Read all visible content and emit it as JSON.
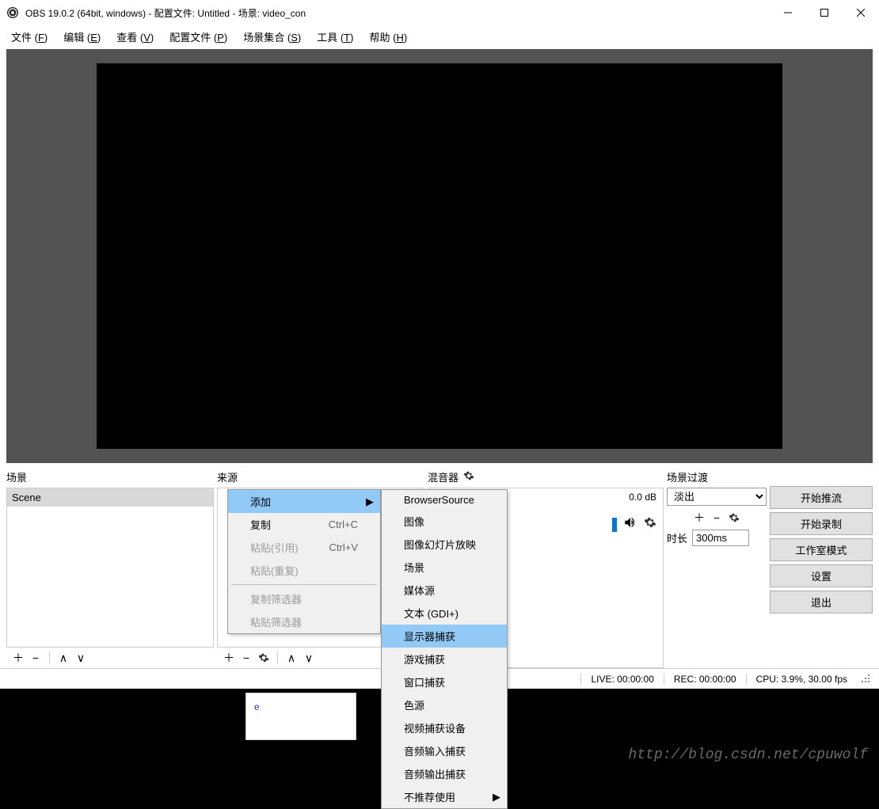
{
  "titlebar": {
    "title": "OBS 19.0.2 (64bit, windows) - 配置文件: Untitled - 场景: video_con"
  },
  "menubar": {
    "items": [
      {
        "label": "文件",
        "accel": "F"
      },
      {
        "label": "编辑",
        "accel": "E"
      },
      {
        "label": "查看",
        "accel": "V"
      },
      {
        "label": "配置文件",
        "accel": "P"
      },
      {
        "label": "场景集合",
        "accel": "S"
      },
      {
        "label": "工具",
        "accel": "T"
      },
      {
        "label": "帮助",
        "accel": "H"
      }
    ]
  },
  "panels": {
    "scenes": {
      "title": "场景",
      "items": [
        "Scene"
      ]
    },
    "sources": {
      "title": "来源"
    },
    "mixer": {
      "title": "混音器",
      "channel_name": "",
      "channel_db": "0.0 dB"
    },
    "transitions": {
      "title": "场景过渡",
      "selected": "淡出",
      "duration_label": "时长",
      "duration_value": "300ms"
    },
    "controls": {
      "buttons": [
        "开始推流",
        "开始录制",
        "工作室模式",
        "设置",
        "退出"
      ]
    }
  },
  "context_menu_1": {
    "items": [
      {
        "label": "添加",
        "submenu": true,
        "highlighted": true
      },
      {
        "label": "复制",
        "shortcut": "Ctrl+C"
      },
      {
        "label": "粘贴(引用)",
        "shortcut": "Ctrl+V",
        "disabled": true
      },
      {
        "label": "粘贴(重复)",
        "disabled": true
      },
      {
        "sep": true
      },
      {
        "label": "复制筛选器",
        "disabled": true
      },
      {
        "label": "粘贴筛选器",
        "disabled": true
      }
    ]
  },
  "context_menu_2": {
    "items": [
      {
        "label": "BrowserSource"
      },
      {
        "label": "图像"
      },
      {
        "label": "图像幻灯片放映"
      },
      {
        "label": "场景"
      },
      {
        "label": "媒体源"
      },
      {
        "label": "文本 (GDI+)"
      },
      {
        "label": "显示器捕获",
        "highlighted": true
      },
      {
        "label": "游戏捕获"
      },
      {
        "label": "窗口捕获"
      },
      {
        "label": "色源"
      },
      {
        "label": "视频捕获设备"
      },
      {
        "label": "音频输入捕获"
      },
      {
        "label": "音频输出捕获"
      },
      {
        "label": "不推荐使用",
        "submenu": true
      }
    ]
  },
  "statusbar": {
    "live": "LIVE: 00:00:00",
    "rec": "REC: 00:00:00",
    "cpu": "CPU: 3.9%, 30.00 fps"
  },
  "watermark": "http://blog.csdn.net/cpuwolf"
}
